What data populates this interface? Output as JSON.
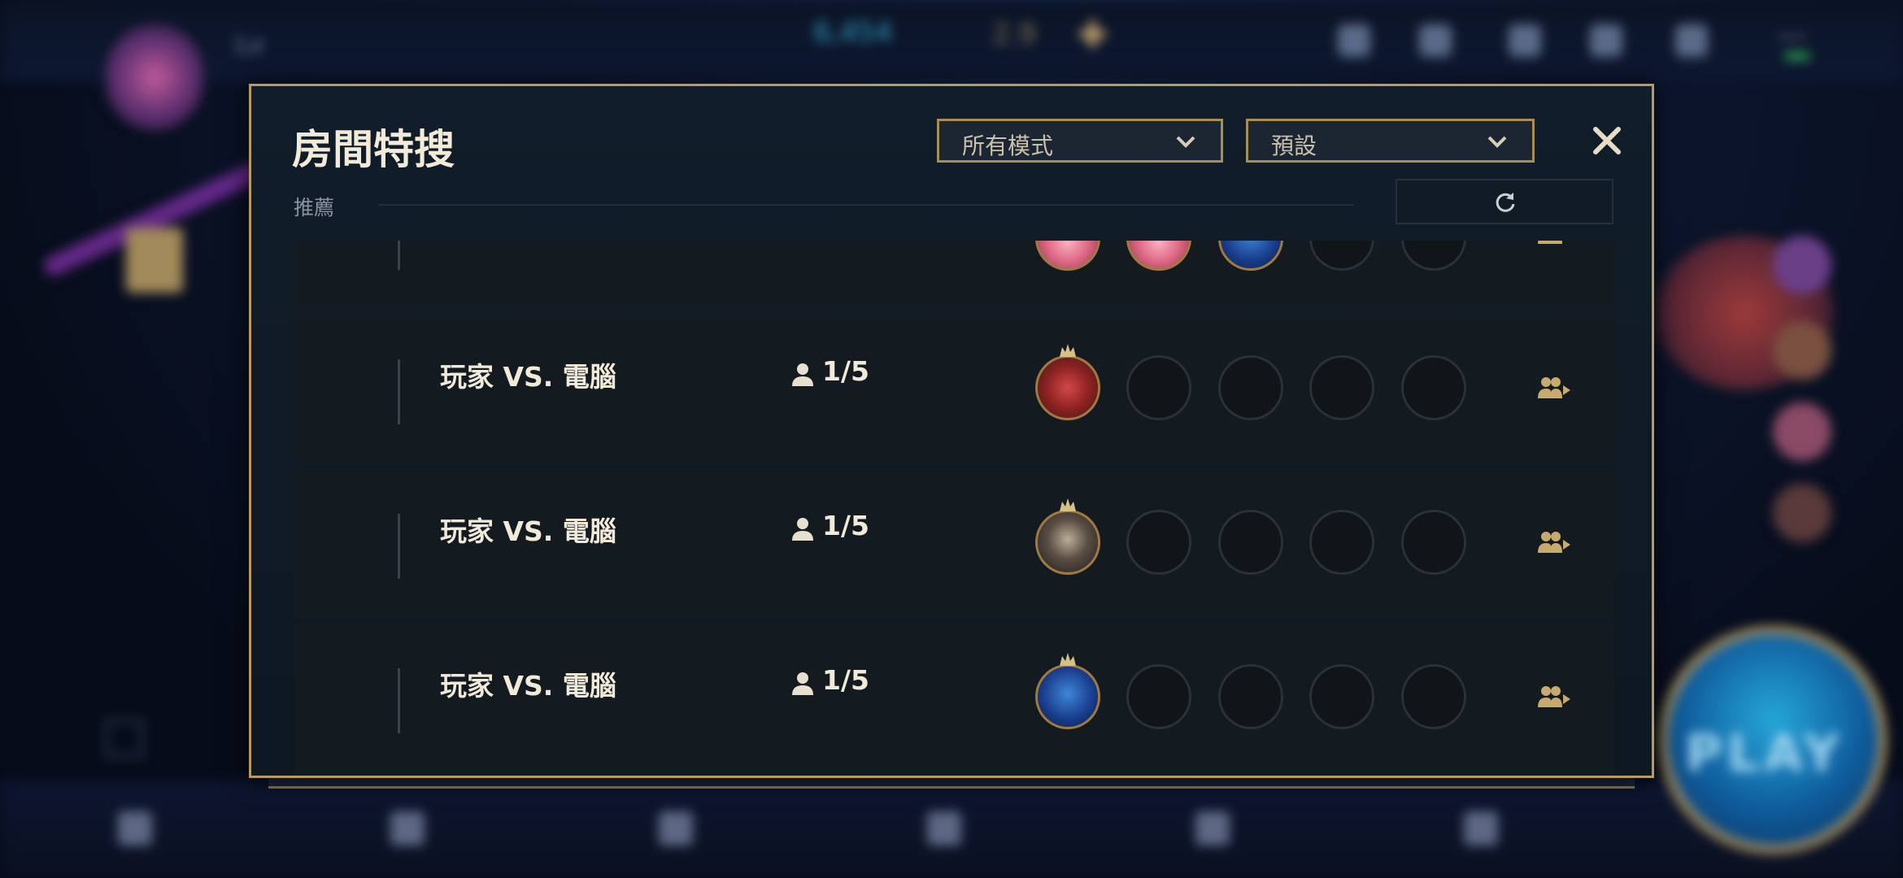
{
  "backdrop": {
    "level_text": "Lv",
    "currency_rp": "6,454",
    "currency_be": "2.9",
    "play_label": "PLAY"
  },
  "dialog": {
    "title": "房間特搜",
    "mode_filter": {
      "selected": "所有模式"
    },
    "sort_filter": {
      "selected": "預設"
    },
    "section_label": "推薦",
    "close_icon": "close-icon",
    "refresh_icon": "refresh-icon"
  },
  "lobbies": [
    {
      "mode": "",
      "players": "",
      "portraits": [
        "pink",
        "pink",
        "blue",
        "empty",
        "empty"
      ]
    },
    {
      "mode": "玩家 VS. 電腦",
      "players": "1/5",
      "portraits": [
        "red",
        "empty",
        "empty",
        "empty",
        "empty"
      ]
    },
    {
      "mode": "玩家 VS. 電腦",
      "players": "1/5",
      "portraits": [
        "dark",
        "empty",
        "empty",
        "empty",
        "empty"
      ]
    },
    {
      "mode": "玩家 VS. 電腦",
      "players": "1/5",
      "portraits": [
        "blue",
        "empty",
        "empty",
        "empty",
        "empty"
      ]
    }
  ],
  "colors": {
    "gold": "#c8aa6e",
    "panel": "#0f1923",
    "text": "#f0e6d2"
  }
}
